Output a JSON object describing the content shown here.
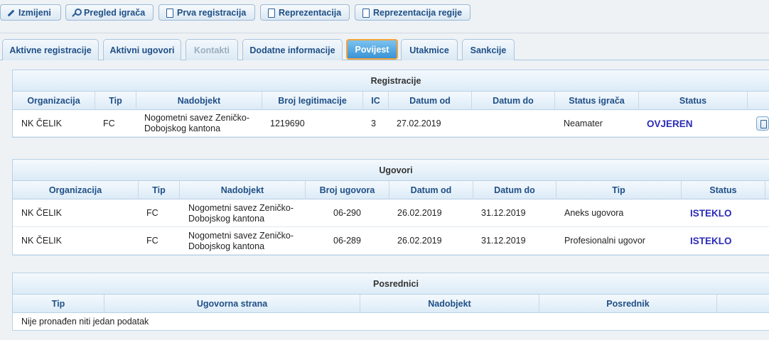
{
  "toolbar": {
    "buttons": [
      {
        "label": "Izmijeni",
        "icon": "pencil-icon"
      },
      {
        "label": "Pregled igrača",
        "icon": "search-icon"
      },
      {
        "label": "Prva registracija",
        "icon": "document-icon"
      },
      {
        "label": "Reprezentacija",
        "icon": "document-icon"
      },
      {
        "label": "Reprezentacija regije",
        "icon": "document-icon"
      }
    ]
  },
  "tabs": [
    {
      "label": "Aktivne registracije",
      "state": "normal"
    },
    {
      "label": "Aktivni ugovori",
      "state": "normal"
    },
    {
      "label": "Kontakti",
      "state": "disabled"
    },
    {
      "label": "Dodatne informacije",
      "state": "normal"
    },
    {
      "label": "Povijest",
      "state": "active"
    },
    {
      "label": "Utakmice",
      "state": "normal"
    },
    {
      "label": "Sankcije",
      "state": "normal"
    }
  ],
  "registracije": {
    "title": "Registracije",
    "columns": [
      "Organizacija",
      "Tip",
      "Nadobjekt",
      "Broj legitimacije",
      "IC",
      "Datum od",
      "Datum do",
      "Status igrača",
      "Status"
    ],
    "rows": [
      {
        "organizacija": "NK ČELIK",
        "tip": "FC",
        "nadobjekt": "Nogometni savez Zeničko-Dobojskog kantona",
        "broj": "1219690",
        "ic": "3",
        "datum_od": "27.02.2019",
        "datum_do": "",
        "status_igraca": "Neamater",
        "status": "OVJEREN"
      }
    ]
  },
  "ugovori": {
    "title": "Ugovori",
    "columns": [
      "Organizacija",
      "Tip",
      "Nadobjekt",
      "Broj ugovora",
      "Datum od",
      "Datum do",
      "Tip",
      "Status"
    ],
    "rows": [
      {
        "organizacija": "NK ČELIK",
        "tip": "FC",
        "nadobjekt": "Nogometni savez Zeničko-Dobojskog kantona",
        "broj": "06-290",
        "datum_od": "26.02.2019",
        "datum_do": "31.12.2019",
        "tip_ugovora": "Aneks ugovora",
        "status": "ISTEKLO"
      },
      {
        "organizacija": "NK ČELIK",
        "tip": "FC",
        "nadobjekt": "Nogometni savez Zeničko-Dobojskog kantona",
        "broj": "06-289",
        "datum_od": "26.02.2019",
        "datum_do": "31.12.2019",
        "tip_ugovora": "Profesionalni ugovor",
        "status": "ISTEKLO"
      }
    ]
  },
  "posrednici": {
    "title": "Posrednici",
    "columns": [
      "Tip",
      "Ugovorna strana",
      "Nadobjekt",
      "Posrednik"
    ],
    "empty_text": "Nije pronađen niti jedan podatak"
  },
  "colors": {
    "accent": "#1f4f86",
    "status": "#2b2bb8",
    "active_tab": "#3a93d6",
    "active_tab_border": "#f0a33a"
  }
}
